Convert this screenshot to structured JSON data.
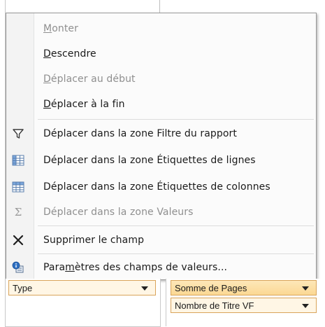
{
  "menu": {
    "items": [
      {
        "label": "Monter",
        "mnemonic": "M",
        "enabled": false,
        "icon": null
      },
      {
        "label": "Descendre",
        "mnemonic": "D",
        "enabled": true,
        "icon": null
      },
      {
        "label": "Déplacer au début",
        "mnemonic": "D",
        "enabled": false,
        "icon": null
      },
      {
        "label": "Déplacer à la fin",
        "mnemonic": "D",
        "enabled": true,
        "icon": null
      },
      {
        "label": "Déplacer dans la zone Filtre du rapport",
        "enabled": true,
        "icon": "filter-funnel-icon"
      },
      {
        "label": "Déplacer dans la zone Étiquettes de lignes",
        "enabled": true,
        "icon": "row-labels-grid-icon"
      },
      {
        "label": "Déplacer dans la zone Étiquettes de colonnes",
        "enabled": true,
        "icon": "column-labels-grid-icon"
      },
      {
        "label": "Déplacer dans la zone Valeurs",
        "enabled": false,
        "icon": "sigma-icon"
      },
      {
        "label": "Supprimer le champ",
        "enabled": true,
        "icon": "remove-x-icon"
      },
      {
        "label": "Paramètres des champs de valeurs...",
        "mnemonic": "m",
        "enabled": true,
        "icon": "field-settings-icon"
      }
    ]
  },
  "zones": {
    "row_field": {
      "label": "Type"
    },
    "values_fields": [
      {
        "label": "Somme de Pages",
        "selected": true
      },
      {
        "label": "Nombre de Titre VF",
        "selected": false
      }
    ]
  },
  "colors": {
    "menu_bg": "#fbfbfb",
    "disabled_text": "#8f8f8f",
    "field_border": "#d9a45a",
    "field_fill": "#fff6e5"
  }
}
